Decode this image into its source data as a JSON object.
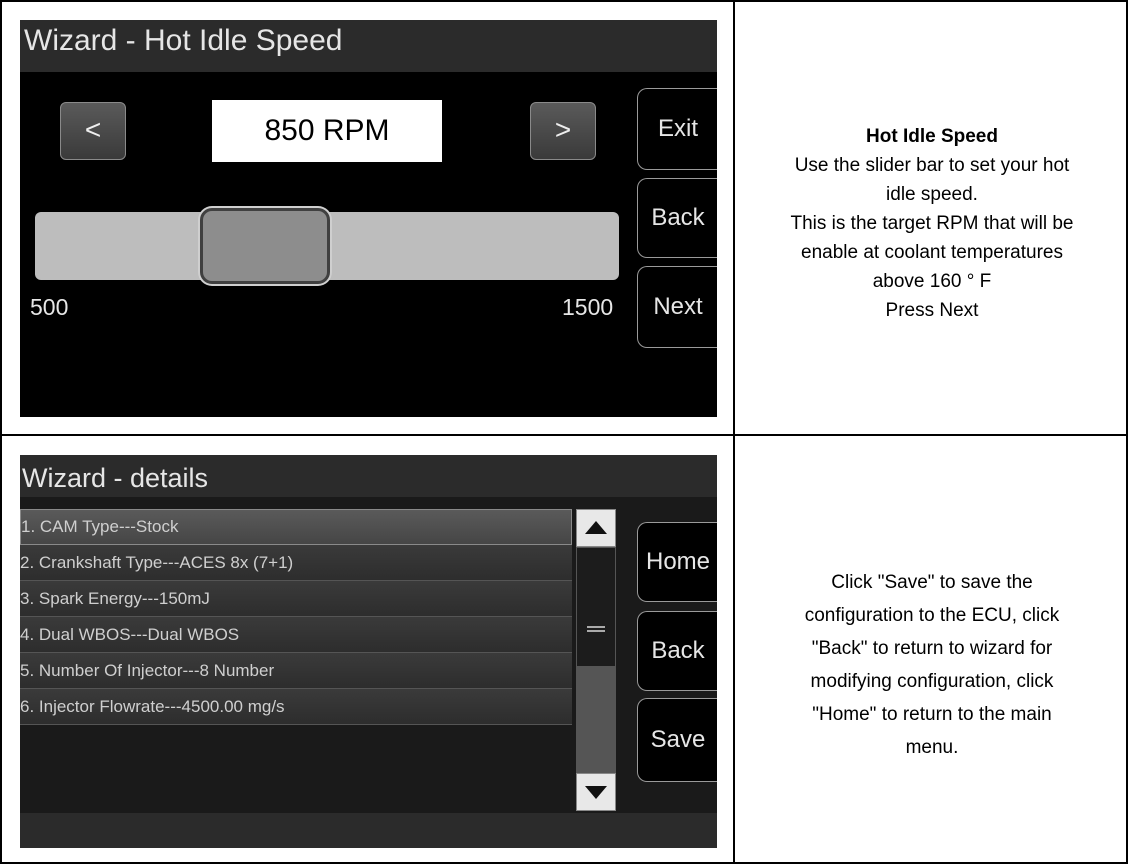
{
  "screen1": {
    "title": "Wizard - Hot Idle Speed",
    "decrement_label": "<",
    "increment_label": ">",
    "rpm_display": "850 RPM",
    "slider": {
      "min_label": "500",
      "max_label": "1500",
      "min": 500,
      "max": 1500,
      "value": 850
    },
    "buttons": {
      "exit": "Exit",
      "back": "Back",
      "next": "Next"
    }
  },
  "info1": {
    "heading": "Hot Idle Speed",
    "lines": [
      "Use the slider bar to set your hot",
      "idle speed.",
      "This is the target RPM that will be",
      "enable at coolant temperatures",
      "above 160 ° F",
      "Press Next"
    ]
  },
  "screen2": {
    "title": "Wizard - details",
    "items": [
      "1. CAM Type---Stock",
      "2. Crankshaft Type---ACES 8x (7+1)",
      "3. Spark Energy---150mJ",
      "4. Dual WBOS---Dual WBOS",
      "5. Number Of Injector---8 Number",
      "6. Injector Flowrate---4500.00 mg/s"
    ],
    "buttons": {
      "home": "Home",
      "back": "Back",
      "save": "Save"
    }
  },
  "info2": {
    "lines": [
      "Click \"Save\" to save the",
      "configuration to the ECU, click",
      "\"Back\" to return to wizard for",
      "modifying configuration, click",
      "\"Home\" to return to the main",
      "menu."
    ]
  }
}
